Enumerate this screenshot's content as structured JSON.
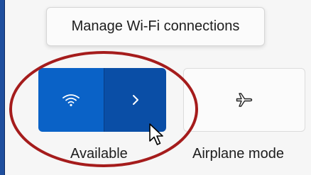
{
  "tooltip": {
    "text": "Manage Wi-Fi connections"
  },
  "quick_settings": {
    "wifi": {
      "label": "Available",
      "state": "on",
      "accent_color": "#0a62c7",
      "expand_color": "#0a4ea6",
      "toggle_icon": "wifi-icon",
      "expand_icon": "chevron-right-icon"
    },
    "airplane": {
      "label": "Airplane mode",
      "state": "off",
      "icon": "airplane-icon"
    }
  },
  "annotation": {
    "highlight_color": "#a51c1c",
    "shape": "ellipse"
  },
  "cursor": {
    "icon": "mouse-pointer-icon"
  }
}
